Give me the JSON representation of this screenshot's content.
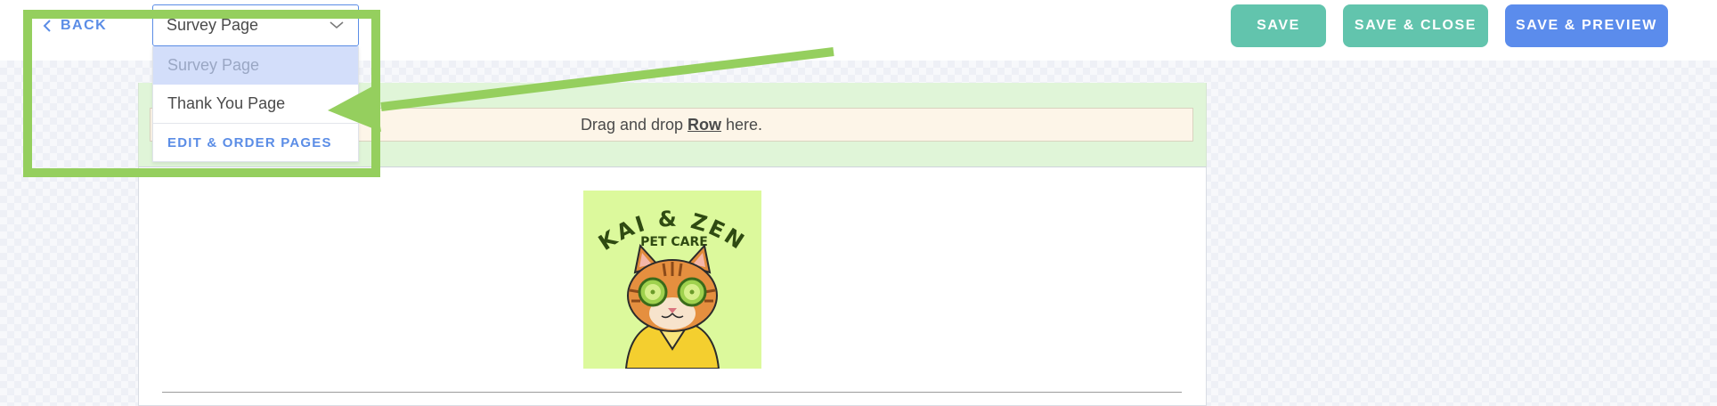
{
  "topbar": {
    "back_label": "BACK",
    "page_select": {
      "value": "Survey Page",
      "options": [
        "Survey Page",
        "Thank You Page"
      ],
      "action_label": "EDIT & ORDER PAGES"
    },
    "buttons": {
      "save": "SAVE",
      "save_close": "SAVE & CLOSE",
      "save_preview": "SAVE & PREVIEW"
    }
  },
  "editor": {
    "drop_prefix": "Drag and drop",
    "drop_keyword": "Row",
    "drop_suffix": "here.",
    "logo": {
      "title_text": "KAI & ZEN",
      "subtitle_text": "PET CARE"
    }
  },
  "colors": {
    "accent_blue": "#5b8de6",
    "save_green": "#62c4ad",
    "preview_blue": "#5b8cec",
    "annotation_green": "#95cf5e",
    "logo_bg": "#dcf99c"
  },
  "icons": {
    "back": "chevron-left-icon",
    "select_caret": "chevron-down-icon"
  }
}
